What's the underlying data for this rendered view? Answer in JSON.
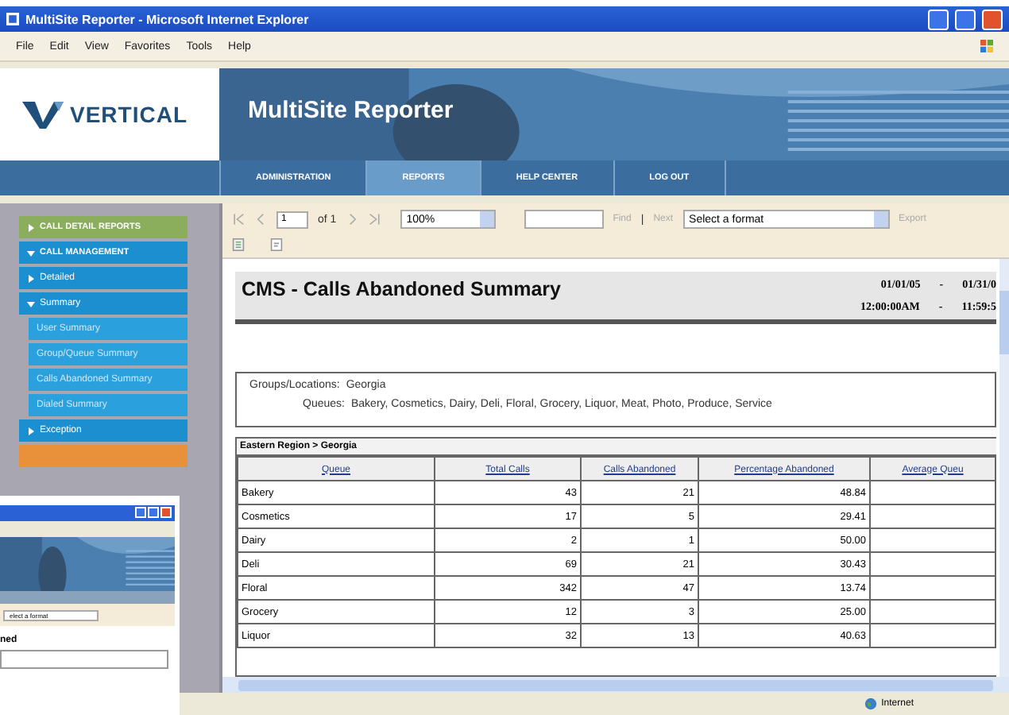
{
  "window": {
    "title": "MultiSite Reporter - Microsoft Internet Explorer"
  },
  "menu": [
    "File",
    "Edit",
    "View",
    "Favorites",
    "Tools",
    "Help"
  ],
  "header": {
    "logo": "VERTICAL",
    "banner_title": "MultiSite Reporter"
  },
  "nav_tabs": [
    {
      "label": "ADMINISTRATION",
      "selected": false
    },
    {
      "label": "REPORTS",
      "selected": true
    },
    {
      "label": "HELP CENTER",
      "selected": false
    },
    {
      "label": "LOG OUT",
      "selected": false
    }
  ],
  "sidebar": {
    "items": [
      {
        "kind": "report",
        "label": "CALL DETAIL REPORTS",
        "expanded": false
      },
      {
        "kind": "section",
        "label": "CALL MANAGEMENT",
        "expanded": true
      },
      {
        "kind": "group",
        "label": "Detailed",
        "expanded": false
      },
      {
        "kind": "group",
        "label": "Summary",
        "expanded": true
      },
      {
        "kind": "sub",
        "label": "User Summary"
      },
      {
        "kind": "sub",
        "label": "Group/Queue Summary"
      },
      {
        "kind": "sub",
        "label": "Calls Abandoned Summary"
      },
      {
        "kind": "sub",
        "label": "Dialed Summary"
      },
      {
        "kind": "group",
        "label": "Exception",
        "expanded": false
      },
      {
        "kind": "accent"
      }
    ]
  },
  "toolbar": {
    "page": "1",
    "page_of": "of 1",
    "zoom": "100%",
    "find": "Find",
    "separator": "|",
    "next": "Next",
    "format": "Select a format",
    "export": "Export"
  },
  "report": {
    "title": "CMS - Calls Abandoned Summary",
    "date_range": [
      {
        "from": "01/01/05",
        "sep": "-",
        "to": "01/31/0"
      },
      {
        "from": "12:00:00AM",
        "sep": "-",
        "to": "11:59:5"
      }
    ],
    "filters": [
      {
        "label": "Groups/Locations:",
        "value": "Georgia"
      },
      {
        "label": "Queues:",
        "value": "Bakery, Cosmetics, Dairy, Deli, Floral, Grocery, Liquor, Meat, Photo, Produce, Service"
      }
    ],
    "table": {
      "caption": "Eastern Region > Georgia",
      "columns": [
        "Queue",
        "Total Calls",
        "Calls Abandoned",
        "Percentage Abandoned",
        "Average Queu"
      ],
      "rows": [
        [
          "Bakery",
          "43",
          "21",
          "48.84"
        ],
        [
          "Cosmetics",
          "17",
          "5",
          "29.41"
        ],
        [
          "Dairy",
          "2",
          "1",
          "50.00"
        ],
        [
          "Deli",
          "69",
          "21",
          "30.43"
        ],
        [
          "Floral",
          "342",
          "47",
          "13.74"
        ],
        [
          "Grocery",
          "12",
          "3",
          "25.00"
        ],
        [
          "Liquor",
          "32",
          "13",
          "40.63"
        ]
      ]
    }
  },
  "status_bar": {
    "zone": "Internet"
  },
  "inset_window": {
    "format": "elect a format",
    "title": "ned"
  }
}
